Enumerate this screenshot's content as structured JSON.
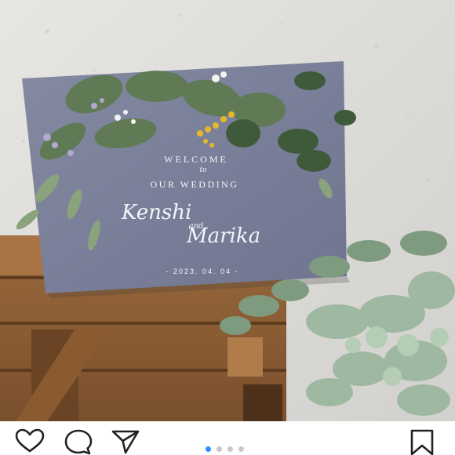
{
  "sign": {
    "line1": "WELCOME",
    "line2": "to",
    "line3": "OUR WEDDING",
    "name1": "Kenshi",
    "and": "and",
    "name2": "Marika",
    "date": "- 2023. 04. 04 -"
  },
  "actions": {
    "like_icon": "heart-icon",
    "comment_icon": "comment-icon",
    "share_icon": "send-icon",
    "save_icon": "bookmark-icon"
  },
  "carousel": {
    "total": 4,
    "active": 1
  },
  "colors": {
    "sign": "#7e859e",
    "accent": "#2f8cff"
  }
}
